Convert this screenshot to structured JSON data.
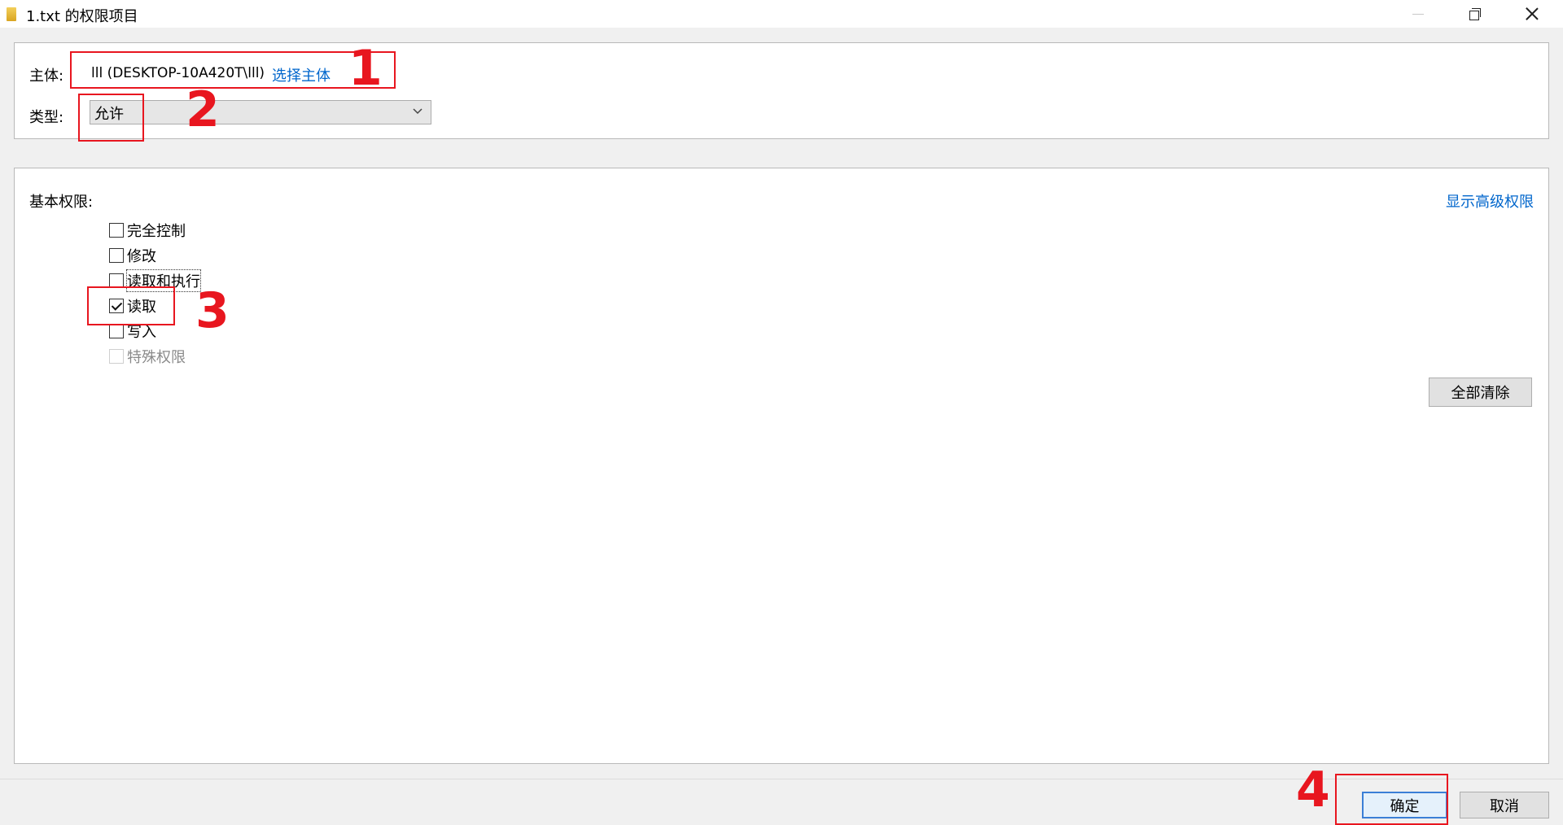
{
  "window": {
    "title": "1.txt 的权限项目",
    "controls": [
      "minimize",
      "restore",
      "close"
    ]
  },
  "principal": {
    "label": "主体:",
    "value": "lll (DESKTOP-10A420T\\lll)",
    "select_link": "选择主体"
  },
  "type": {
    "label": "类型:",
    "selected": "允许"
  },
  "permissions": {
    "label": "基本权限:",
    "advanced_link": "显示高级权限",
    "items": [
      {
        "label": "完全控制",
        "checked": false,
        "disabled": false
      },
      {
        "label": "修改",
        "checked": false,
        "disabled": false
      },
      {
        "label": "读取和执行",
        "checked": false,
        "disabled": false
      },
      {
        "label": "读取",
        "checked": true,
        "disabled": false
      },
      {
        "label": "写入",
        "checked": false,
        "disabled": false
      },
      {
        "label": "特殊权限",
        "checked": false,
        "disabled": true
      }
    ],
    "clear_all": "全部清除"
  },
  "buttons": {
    "ok": "确定",
    "cancel": "取消"
  },
  "annotations": {
    "color": "#e8161f",
    "labels": [
      "1",
      "2",
      "3",
      "4"
    ]
  },
  "colors": {
    "link": "#0066cc",
    "default_button_border": "#3b7fd6"
  }
}
